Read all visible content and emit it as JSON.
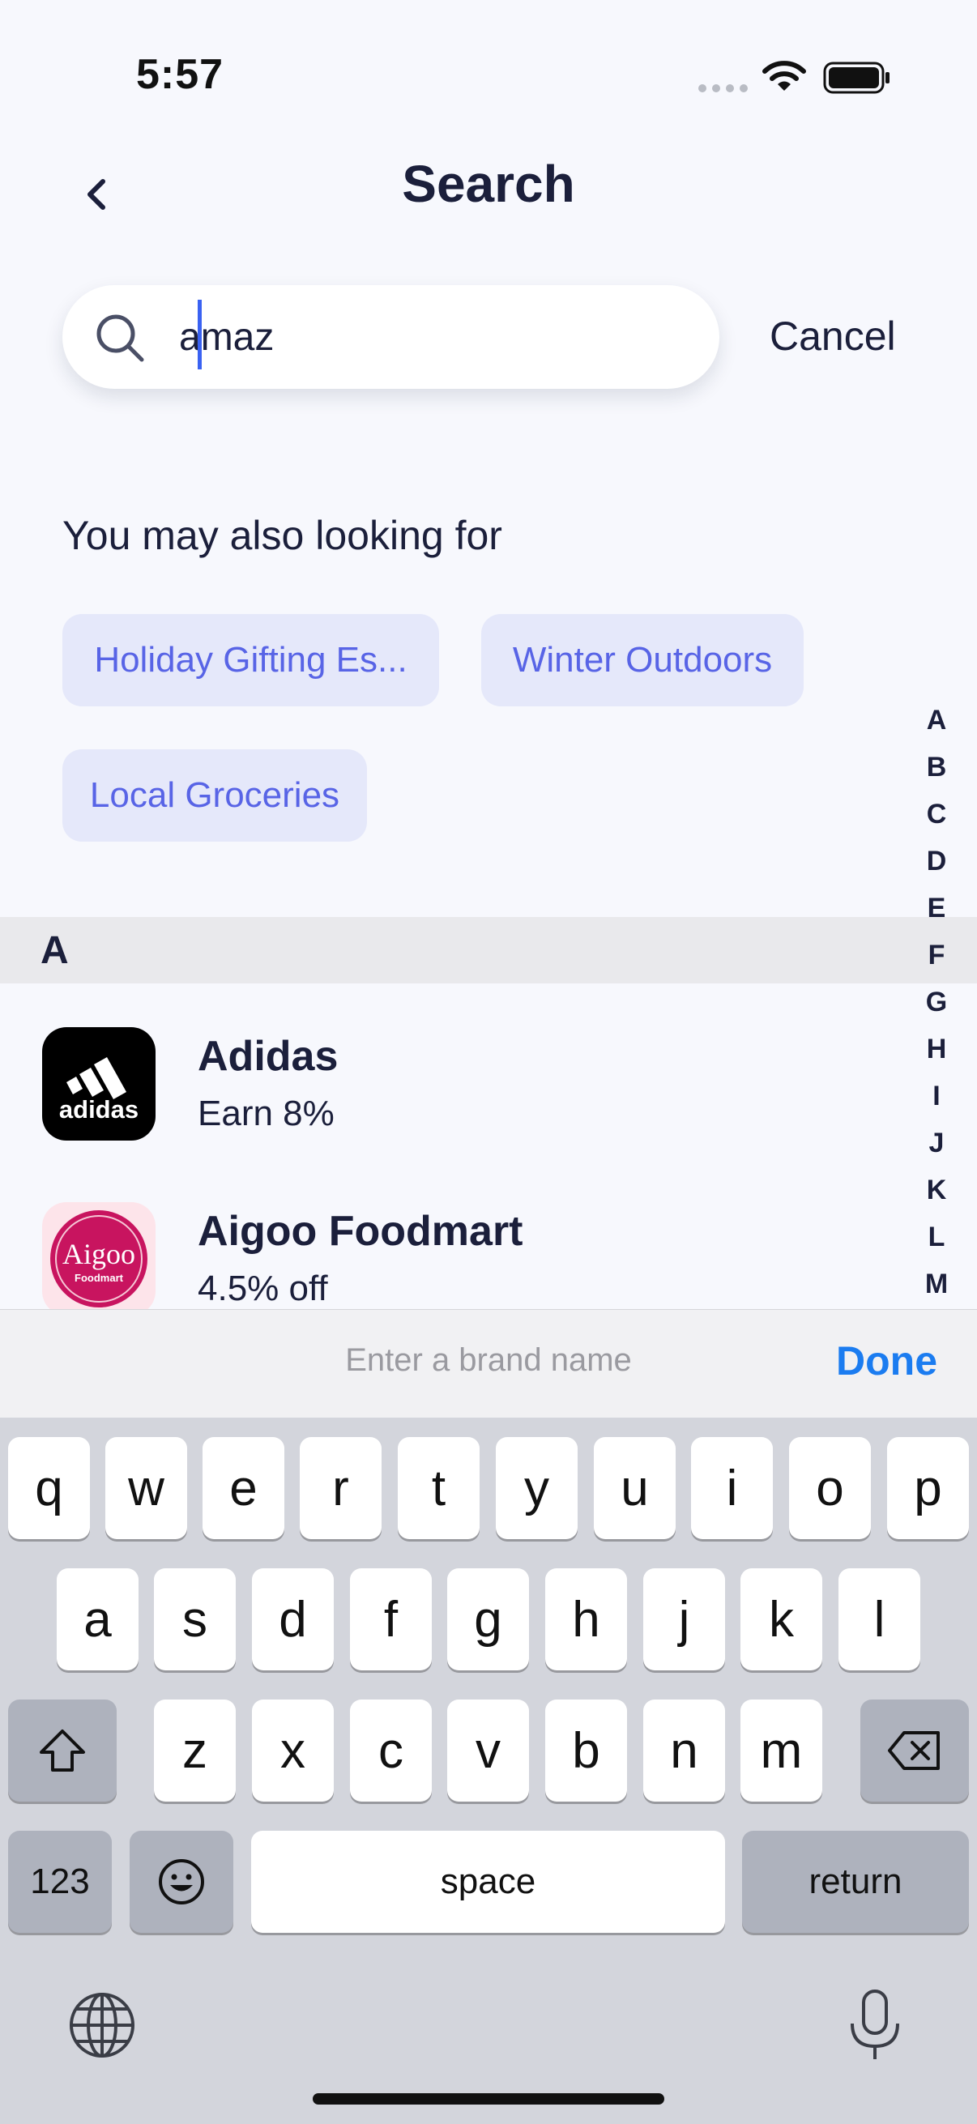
{
  "status": {
    "time": "5:57"
  },
  "header": {
    "title": "Search"
  },
  "search": {
    "value": "amaz",
    "cancel_label": "Cancel"
  },
  "suggestions": {
    "heading": "You may also looking for",
    "chips": [
      "Holiday Gifting Es...",
      "Winter Outdoors",
      "Local Groceries"
    ]
  },
  "alpha_index": [
    "A",
    "B",
    "C",
    "D",
    "E",
    "F",
    "G",
    "H",
    "I",
    "J",
    "K",
    "L",
    "M"
  ],
  "section": {
    "letter": "A"
  },
  "brands": [
    {
      "name": "Adidas",
      "offer": "Earn 8%",
      "logo_text": "adidas",
      "logo_icon": "adidas-logo-icon"
    },
    {
      "name": "Aigoo Foodmart",
      "offer": "4.5% off",
      "logo_text": "Aigoo",
      "logo_subtext": "Foodmart",
      "logo_icon": "aigoo-logo-icon"
    }
  ],
  "accessory": {
    "placeholder": "Enter a brand name",
    "done_label": "Done"
  },
  "keyboard": {
    "row1": [
      "q",
      "w",
      "e",
      "r",
      "t",
      "y",
      "u",
      "i",
      "o",
      "p"
    ],
    "row2": [
      "a",
      "s",
      "d",
      "f",
      "g",
      "h",
      "j",
      "k",
      "l"
    ],
    "row3": [
      "z",
      "x",
      "c",
      "v",
      "b",
      "n",
      "m"
    ],
    "numbers_label": "123",
    "space_label": "space",
    "return_label": "return"
  },
  "colors": {
    "accent": "#5864e6",
    "chip_bg": "#e5e8fa",
    "done": "#1b7cf0",
    "caret": "#3a62f2"
  }
}
